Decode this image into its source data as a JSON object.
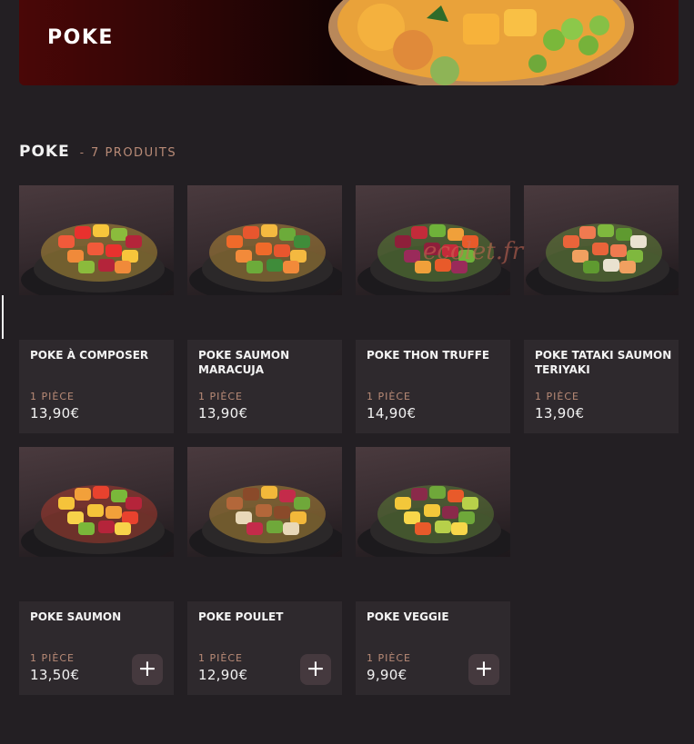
{
  "banner": {
    "title": "POKE"
  },
  "section": {
    "title": "POKE",
    "separator": "-",
    "count": "7 PRODUITS"
  },
  "watermark": "ecolet.fr",
  "products": [
    {
      "name": "POKE À COMPOSER",
      "unit": "1 PIÈCE",
      "price": "13,90€",
      "has_add": false,
      "image": "poke-a-composer-bowl-image"
    },
    {
      "name": "POKE SAUMON MARACUJA",
      "unit": "1 PIÈCE",
      "price": "13,90€",
      "has_add": false,
      "image": "poke-saumon-maracuja-bowl-image"
    },
    {
      "name": "POKE THON TRUFFE",
      "unit": "1 PIÈCE",
      "price": "14,90€",
      "has_add": false,
      "image": "poke-thon-truffe-bowl-image"
    },
    {
      "name": "POKE TATAKI SAUMON TERIYAKI",
      "unit": "1 PIÈCE",
      "price": "13,90€",
      "has_add": false,
      "image": "poke-tataki-saumon-bowl-image"
    },
    {
      "name": "POKE SAUMON",
      "unit": "1 PIÈCE",
      "price": "13,50€",
      "has_add": true,
      "add_label": "+",
      "image": "poke-saumon-bowl-image"
    },
    {
      "name": "POKE POULET",
      "unit": "1 PIÈCE",
      "price": "12,90€",
      "has_add": true,
      "add_label": "+",
      "image": "poke-poulet-bowl-image"
    },
    {
      "name": "POKE VEGGIE",
      "unit": "1 PIÈCE",
      "price": "9,90€",
      "has_add": true,
      "add_label": "+",
      "image": "poke-veggie-bowl-image"
    }
  ],
  "colors": {
    "background": "#231f23",
    "card": "#2e292d",
    "accent": "#b98b77",
    "button": "#45393e"
  }
}
